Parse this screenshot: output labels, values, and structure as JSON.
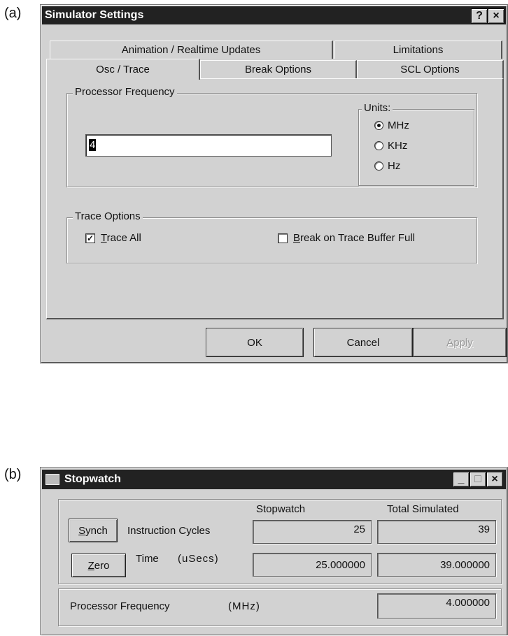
{
  "labels": {
    "a": "(a)",
    "b": "(b)"
  },
  "simulator": {
    "title": "Simulator Settings",
    "help_glyph": "?",
    "close_glyph": "×",
    "tabs_back": [
      "Animation / Realtime Updates",
      "Limitations"
    ],
    "tabs_front": [
      "Osc / Trace",
      "Break Options",
      "SCL Options"
    ],
    "freq_group": "Processor Frequency",
    "freq_value": "4",
    "units_group": "Units:",
    "units": [
      {
        "label": "MHz",
        "selected": true
      },
      {
        "label": "KHz",
        "selected": false
      },
      {
        "label": "Hz",
        "selected": false
      }
    ],
    "trace_group": "Trace Options",
    "trace_all_mn": "T",
    "trace_all_rest": "race All",
    "trace_all_checked": "✓",
    "break_mn": "B",
    "break_rest": "reak on Trace Buffer Full",
    "ok": "OK",
    "cancel": "Cancel",
    "apply": "Apply"
  },
  "stopwatch": {
    "title": "Stopwatch",
    "min_glyph": "_",
    "max_glyph": "□",
    "close_glyph": "×",
    "col_stopwatch": "Stopwatch",
    "col_total": "Total Simulated",
    "synch_mn": "S",
    "synch_rest": "ynch",
    "zero_mn": "Z",
    "zero_rest": "ero",
    "row1_label": "Instruction Cycles",
    "row1_sw": "25",
    "row1_total": "39",
    "row2_label": "Time",
    "row2_unit": "(uSecs)",
    "row2_sw": "25.000000",
    "row2_total": "39.000000",
    "freq_label": "Processor Frequency",
    "freq_unit": "(MHz)",
    "freq_value": "4.000000"
  }
}
